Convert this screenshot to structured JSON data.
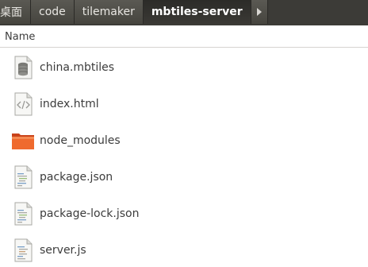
{
  "pathbar": {
    "crumbs": [
      "桌面",
      "code",
      "tilemaker",
      "mbtiles-server"
    ],
    "active_index": 3,
    "scroll_icon": "chevron-right-icon"
  },
  "header": {
    "name_column": "Name"
  },
  "files": [
    {
      "name": "china.mbtiles",
      "icon": "database-file-icon"
    },
    {
      "name": "index.html",
      "icon": "html-file-icon"
    },
    {
      "name": "node_modules",
      "icon": "folder-icon"
    },
    {
      "name": "package.json",
      "icon": "text-file-icon"
    },
    {
      "name": "package-lock.json",
      "icon": "text-file-icon"
    },
    {
      "name": "server.js",
      "icon": "script-file-icon"
    }
  ],
  "colors": {
    "pathbar_bg": "#3c3b37",
    "folder_orange": "#e95420"
  }
}
